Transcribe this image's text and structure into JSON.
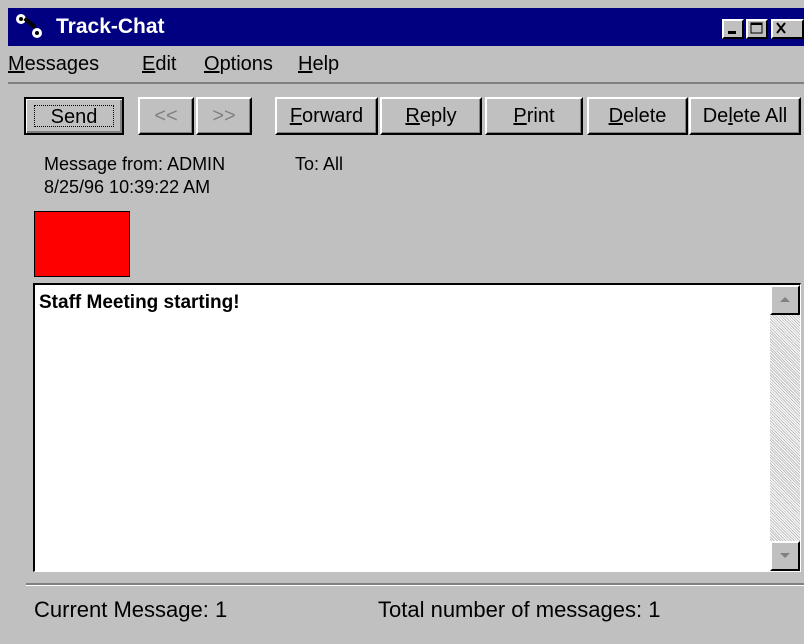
{
  "window": {
    "title": "Track-Chat"
  },
  "menu": {
    "messages": {
      "first": "M",
      "rest": "essages"
    },
    "edit": {
      "first": "E",
      "rest": "dit"
    },
    "options": {
      "first": "O",
      "rest": "ptions"
    },
    "help": {
      "first": "H",
      "rest": "elp"
    }
  },
  "toolbar": {
    "send": "Send",
    "prev": "<<",
    "next": ">>",
    "forward": {
      "first": "F",
      "rest": "orward"
    },
    "reply": {
      "first": "R",
      "rest": "eply"
    },
    "print": {
      "first": "P",
      "rest": "rint"
    },
    "delete": {
      "first": "D",
      "rest": "elete"
    },
    "delete_all": {
      "pre": "De",
      "ul": "l",
      "post": "ete All"
    }
  },
  "message": {
    "from_label": "Message from:",
    "from": "ADMIN",
    "to_label": "To:",
    "to": "All",
    "date": "8/25/96 10:39:22 AM",
    "color": "#ff0000",
    "body": "Staff Meeting starting!"
  },
  "status": {
    "current_label": "Current Message:",
    "current": "1",
    "total_label": "Total number of messages:",
    "total": "1"
  }
}
